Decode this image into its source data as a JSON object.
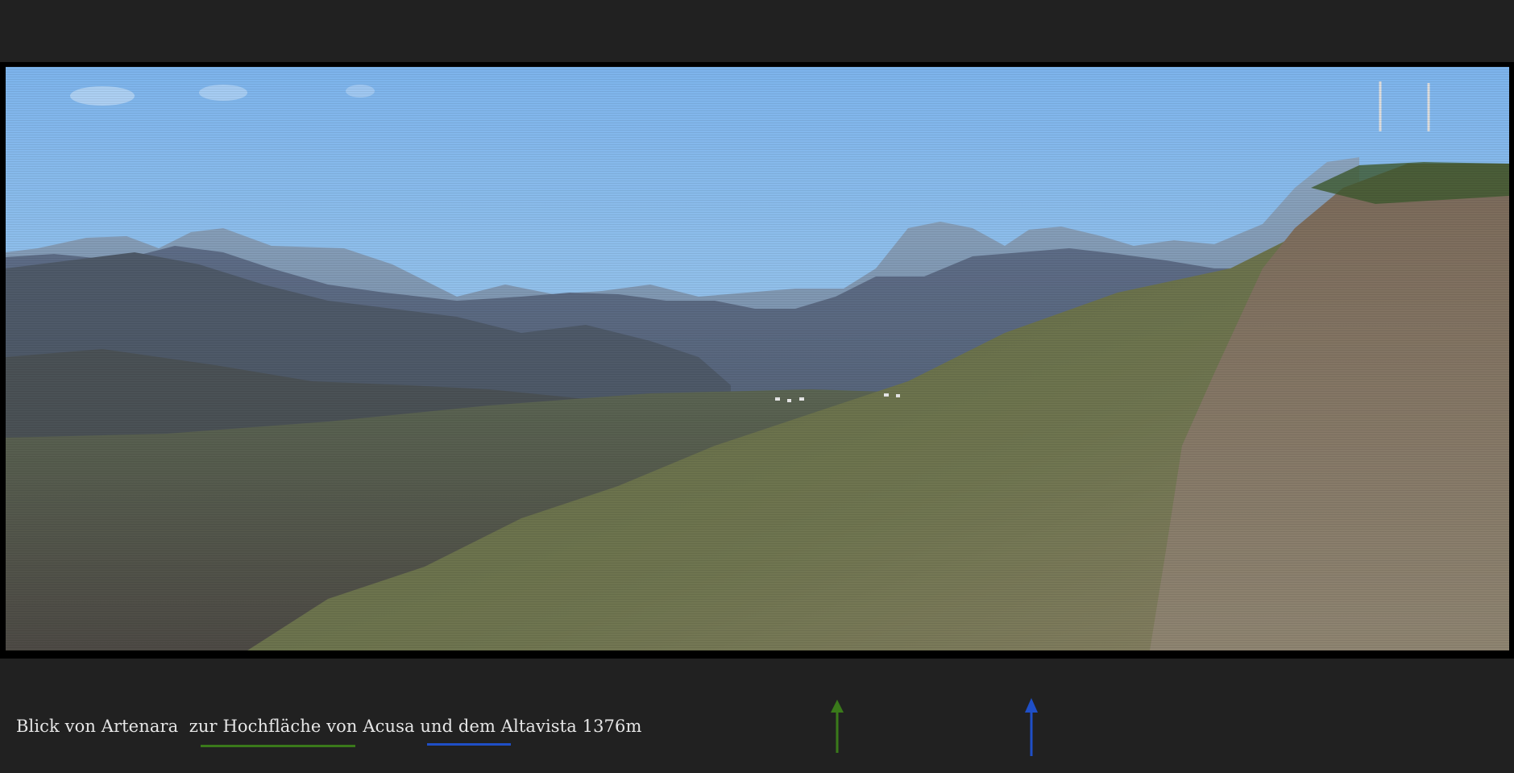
{
  "caption": {
    "part1": "Blick von Artenara  zur ",
    "part2": "Hochfläche von Acusa",
    "part3": " und dem ",
    "part4": "Altavista 1376m"
  },
  "colors": {
    "background": "#212121",
    "green_marker": "#3a7a1a",
    "blue_marker": "#1f4fc7",
    "sky_top": "#7fb6ea",
    "sky_bottom": "#a9cde6"
  },
  "markers": [
    {
      "name": "green-arrow-icon",
      "color": "#3a7a1a"
    },
    {
      "name": "blue-arrow-icon",
      "color": "#1f4fc7"
    }
  ]
}
